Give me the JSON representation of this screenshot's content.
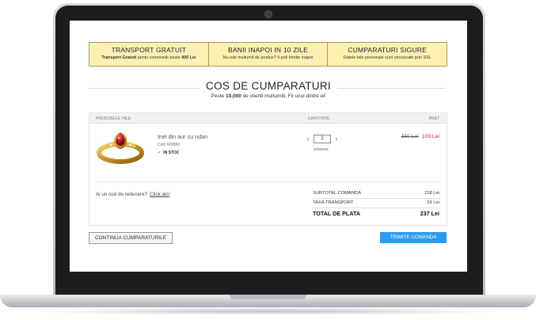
{
  "banner": [
    {
      "title": "TRANSPORT GRATUIT",
      "sub_bold": "Transport Gratuit",
      "sub_text": " pentu comenzile peste ",
      "sub_bold2": "400 Lei"
    },
    {
      "title": "BANII INAPOI IN 10 ZILE",
      "sub_text": "Nu esti multumit de produs? Il poti trimite inapoi"
    },
    {
      "title": "CUMPARATURI SIGURE",
      "sub_text": "Datele tale personale sunt securizate prin SSL"
    }
  ],
  "page": {
    "title": "COS DE CUMPARATURI",
    "subtitle_pre": "Peste ",
    "subtitle_bold": "10,000",
    "subtitle_post": " de clienti multumiti. Fii unul dintre ei!"
  },
  "cart": {
    "headers": {
      "product": "PRODUSELE TALE",
      "quantity": "CANTITATE",
      "price": "PRET"
    },
    "item": {
      "name": "Inel din aur cu rubin",
      "code": "Cod: IR9990",
      "stock": "IN STOC",
      "quantity": "2",
      "delete_label": "STERGE",
      "old_price": "150 Lei",
      "new_price": "109 Lei"
    },
    "coupon": {
      "question": "Ai un cod de reducere?",
      "link": "Click aici"
    },
    "summary": {
      "subtotal_label": "SUBTOTAL COMANDA",
      "subtotal_value": "218 Lei",
      "transport_label": "TAXA TRANSPORT",
      "transport_value": "19 Lei",
      "total_label": "TOTAL DE PLATA",
      "total_value": "237 Lei"
    }
  },
  "actions": {
    "continue": "CONTINUA CUMPARATURILE",
    "submit": "TRIMITE COMANDA"
  },
  "colors": {
    "banner_bg": "#fdf1b2",
    "accent_button": "#2b9bf0",
    "sale_price": "#e2202a"
  },
  "icons": {
    "qty_decrease": "chevron-left-icon",
    "qty_increase": "chevron-right-icon",
    "stock": "check-icon"
  }
}
